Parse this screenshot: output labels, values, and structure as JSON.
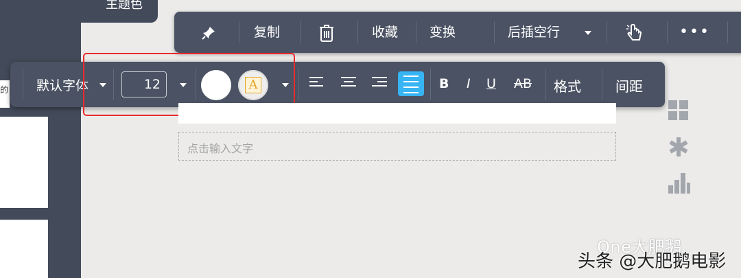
{
  "theme_tab": {
    "label": "主题色"
  },
  "edge_text": "的",
  "context_toolbar": {
    "copy": "复制",
    "favorite": "收藏",
    "transform": "变换",
    "insert_row_after": "后插空行",
    "more": "•••"
  },
  "format_toolbar": {
    "font_family": "默认字体",
    "font_size": "12",
    "bold": "B",
    "italic": "I",
    "underline": "U",
    "strikethrough": "AB",
    "format": "格式",
    "spacing": "间距",
    "text_color_glyph": "A"
  },
  "text_input": {
    "placeholder": "点击输入文字"
  },
  "watermark": {
    "line1": "One大肥鹅",
    "line2": "头条 @大肥鹅电影"
  },
  "colors": {
    "toolbar_bg": "#4a5263",
    "active_blue": "#37b4f3",
    "highlight_red": "#ea2b2b"
  }
}
